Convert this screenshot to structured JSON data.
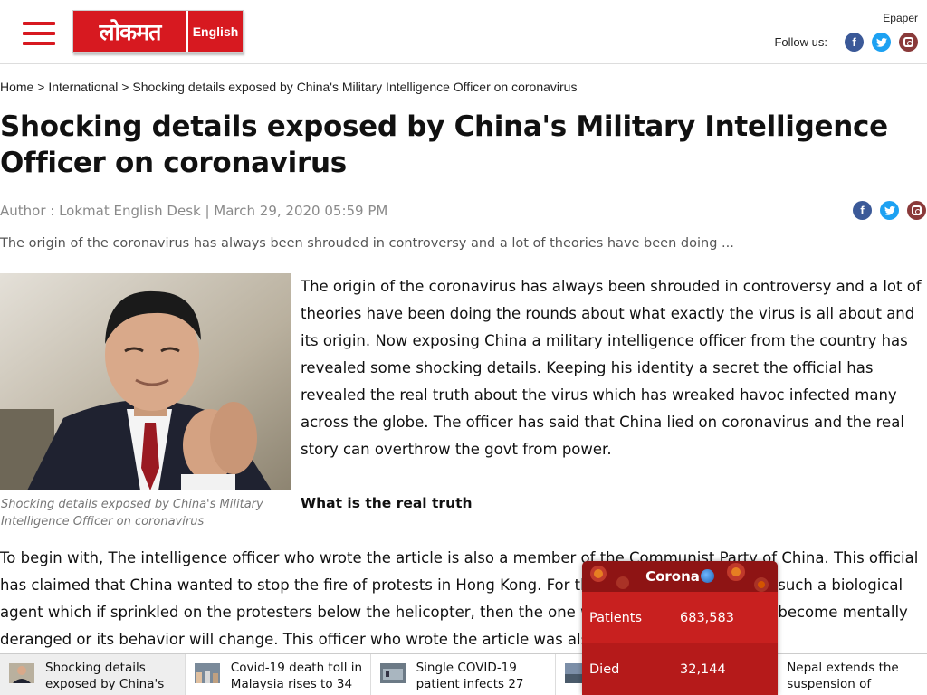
{
  "header": {
    "logo_main": "लोकमत",
    "logo_sub": "English",
    "epaper": "Epaper",
    "follow_label": "Follow us:"
  },
  "breadcrumb": {
    "home": "Home",
    "sep": " > ",
    "section": "International",
    "current": "Shocking details exposed by China's Military Intelligence Officer on coronavirus"
  },
  "article": {
    "title": "Shocking details exposed by China's Military Intelligence Officer on coronavirus",
    "meta": "Author : Lokmat English Desk | March 29, 2020 05:59 PM",
    "summary": "The origin of the coronavirus has always been shrouded in controversy and a lot of theories have been doing ...",
    "image_caption": "Shocking details exposed by China's Military Intelligence Officer on coronavirus",
    "paragraph1": "The origin of the coronavirus has always been shrouded in controversy and a lot of theories have been doing the rounds about what exactly the virus is all about and its origin. Now exposing China a military intelligence officer from the country has revealed some shocking details. Keeping his identity a secret the official has revealed the real truth about the virus which has wreaked havoc infected many across the globe. The officer has said that China lied on coronavirus and the real story can overthrow the govt from power.",
    "subheading": "What is the real truth",
    "paragraph2": "To begin with, The intelligence officer who wrote the article is also a member of the Communist Party of China. This official has claimed that China wanted to stop the fire of protests in Hong Kong. For this, they were developing such a biological agent which if sprinkled on the protesters below the helicopter, then the one who comes in contact will become mentally deranged or its behavior will change. This officer who wrote the article was also in a lab in China."
  },
  "related": [
    {
      "title": "Shocking details exposed by China's"
    },
    {
      "title": "Covid-19 death toll in Malaysia rises to 34"
    },
    {
      "title": "Single COVID-19 patient infects 27"
    },
    {
      "title": ""
    },
    {
      "title": "Nepal extends the suspension of"
    }
  ],
  "corona_widget": {
    "title": "Corona",
    "patients_label": "Patients",
    "patients_value": "683,583",
    "died_label": "Died",
    "died_value": "32,144"
  },
  "icons": [
    "menu-icon",
    "facebook-icon",
    "twitter-icon",
    "instagram-icon",
    "globe-icon"
  ],
  "colors": {
    "brand_red": "#d71920",
    "facebook": "#3b5998",
    "twitter": "#1da1f2",
    "instagram": "#8a3a3a",
    "widget_red": "#b81c1c"
  }
}
